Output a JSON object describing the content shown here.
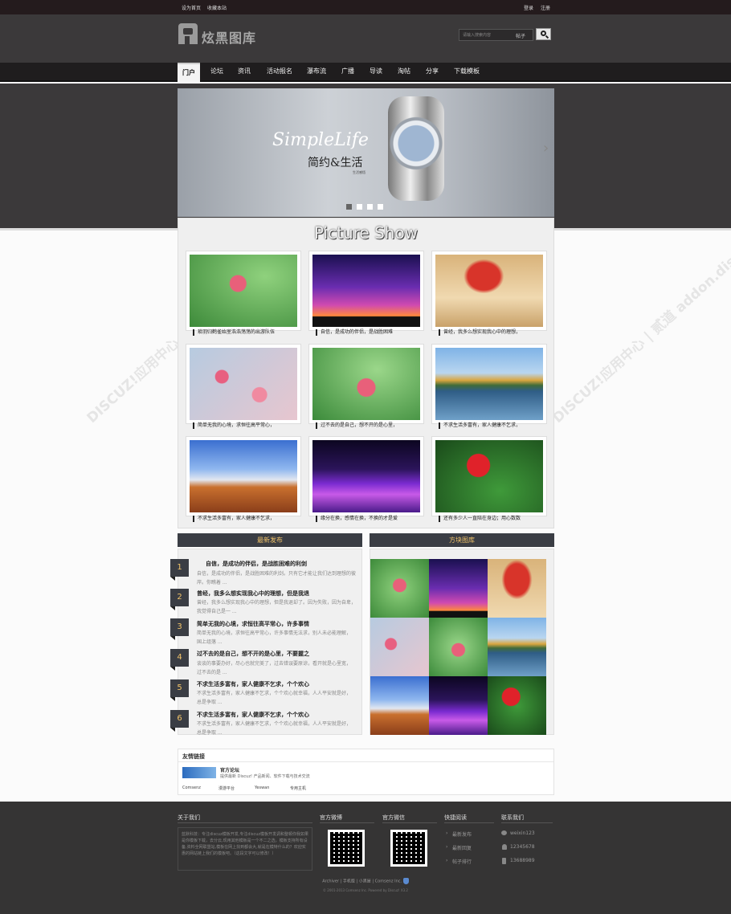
{
  "topbar": {
    "left_links": [
      "设为首页",
      "收藏本站"
    ],
    "right_links": [
      "登录",
      "注册"
    ]
  },
  "header": {
    "logo_text": "炫黑图库",
    "search_placeholder": "请输入搜索内容",
    "search_type": "帖子"
  },
  "nav": {
    "items": [
      "门户",
      "论坛",
      "资讯",
      "活动报名",
      "瀑布流",
      "广播",
      "导读",
      "淘帖",
      "分享",
      "下载模板"
    ],
    "active": "门户"
  },
  "banner": {
    "title_en": "SimpleLife",
    "title_cn": "简约&生活",
    "small": "生活感悟"
  },
  "picture_show": {
    "title": "Picture Show",
    "captions": [
      "琐羽归鹤雀始室浩浩荡荡的出游队伍",
      "自信，是成功的伴侣，是战胜困难",
      "曾经，我多么想实现我心中的理想，",
      "简单无我的心境，求恒往高平常心，",
      "过不去的是自己，想不开的是心里，",
      "不求生活多富有，家人健康不乞求，",
      "不求生活多富有，家人健康不乞求，",
      "缘分在换，感情在换，不换的才是爱",
      "还有多少人一直陪在身边；用心数数"
    ]
  },
  "latest": {
    "heading": "最新发布",
    "items": [
      {
        "num": "1",
        "title": "自信，是成功的伴侣，是战胜困难的利剑",
        "desc": "自信，是成功的伴侣，是战胜困难的利剑。只有它才能让我们达到理想的彼岸。你瞧着 ..."
      },
      {
        "num": "2",
        "title": "曾经，我多么想实现我心中的理想，但是我退",
        "desc": "曾经，我多么想实现我心中的理想，但是我退却了。因为失败，因为自卑，我觉得自己是一 ..."
      },
      {
        "num": "3",
        "title": "简单无我的心境，求恒往高平常心，许多事情",
        "desc": "简单无我的心境，求恒往高平常心，许多事情无法求，别人未必能理解，　　国上组落 ..."
      },
      {
        "num": "4",
        "title": "过不去的是自己，想不开的是心里，不要握之",
        "desc": "谈谈的事要办好，尽心也就完美了，过去错误要原谅，看开就是心里宽，　　过不去的是 ..."
      },
      {
        "num": "5",
        "title": "不求生活多富有，家人健康不乞求，个个欢心",
        "desc": "不求生活多富有，家人健康不乞求，个个欢心就幸福，人人平安就是好，　　总是争取 ..."
      },
      {
        "num": "6",
        "title": "不求生活多富有，家人健康不乞求，个个欢心",
        "desc": "不求生活多富有，家人健康不乞求，个个欢心就幸福，人人平安就是好，　　总是争取 ..."
      }
    ]
  },
  "grid": {
    "heading": "方块图库"
  },
  "friendlinks": {
    "heading": "友情链接",
    "featured_title": "官方论坛",
    "featured_desc": "提供最新 Discuz! 产品新闻、软件下载与技术交流",
    "links": [
      "Comsenz",
      "漫游平台",
      "Yeswan",
      "专用主机"
    ]
  },
  "footer": {
    "about_heading": "关于我们",
    "about_text": "蓝默科技：专注discuz模板开发,专注discuz模板开发调和整顿你我如果是你模板下载，去分云,现用其他模板是一个不二之选，模板支持所有设备,资料全网联盟站,模板在网上找到都会大,就是在模特什么的？欢迎实惠的网站链上我们的模板吧。（这段文字可以修改！）",
    "weibo_heading": "官方微博",
    "wechat_heading": "官方微信",
    "quick_heading": "快捷阅读",
    "quick_links": [
      "最新发布",
      "最新回复",
      "帖子排行"
    ],
    "contact_heading": "联系我们",
    "contact": [
      "weixin123",
      "12345678",
      "13688989"
    ],
    "bottom_links": [
      "Archiver",
      "手机版",
      "小黑屋",
      "Comsenz Inc."
    ],
    "copyright": "© 2001-2013 Comsenz Inc. Powered by Discuz! X3.2"
  },
  "watermark": "DISCUZ!应用中心 | 贰道 addon.dismall.com"
}
